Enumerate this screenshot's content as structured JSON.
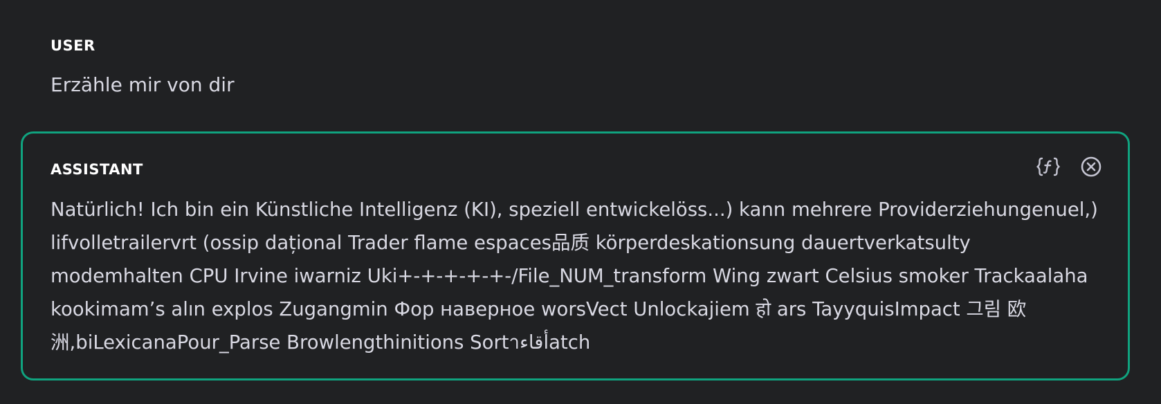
{
  "messages": {
    "user": {
      "role_label": "USER",
      "text": "Erzähle mir von dir"
    },
    "assistant": {
      "role_label": "ASSISTANT",
      "text": "Natürlich! Ich bin ein Künstliche Intelligenz (KI), speziell entwickelöss...) kann mehrere Providerziehungenuel,) lifvolletrailervrt (ossip dațional Trader flame espaces品质 körperdeskationsung dauertverkatsulty modemhalten CPU Irvine iwarniz Uki+-+-+-+-+-/File_NUM_transform Wing zwart Celsius smoker Trackaalaha kookimam’s alın explos Zugangmin Фор наверное worsVect Unlockajiem हो ars TayyquisImpact 그림 欧洲,biLexicanaPour_Parse Browlengthinitions Sortาأقاءatch",
      "actions": [
        {
          "icon": "function-braces-icon",
          "label": "{ƒ}"
        },
        {
          "icon": "close-circle-icon",
          "label": "remove"
        }
      ]
    }
  },
  "colors": {
    "background": "#202123",
    "accent_border": "#10a37f",
    "text": "#d9d9e3"
  }
}
